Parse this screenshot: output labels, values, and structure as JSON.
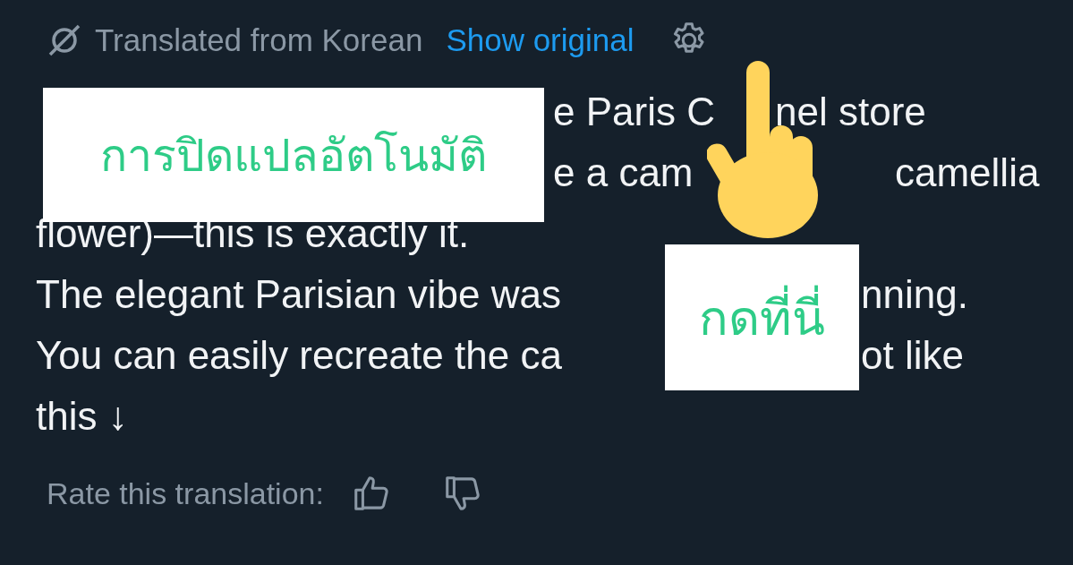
{
  "header": {
    "status": "Translated from Korean",
    "link": "Show original"
  },
  "lines": [
    {
      "segments": [
        "e Paris C",
        "nel store"
      ]
    },
    {
      "segments": [
        "e a cam",
        "camellia"
      ]
    },
    {
      "segments": [
        "flower)—this is exactly it."
      ]
    },
    {
      "segments": [
        "The elegant Parisian vibe was",
        "nning."
      ]
    },
    {
      "segments": [
        "You can easily recreate the ca",
        "ot like"
      ]
    },
    {
      "segments": [
        "this ↓"
      ]
    }
  ],
  "footer": {
    "label": "Rate this translation:"
  },
  "callouts": [
    {
      "text": "การปิดแปลอัตโนมัติ"
    },
    {
      "text": "กดที่นี่"
    }
  ]
}
